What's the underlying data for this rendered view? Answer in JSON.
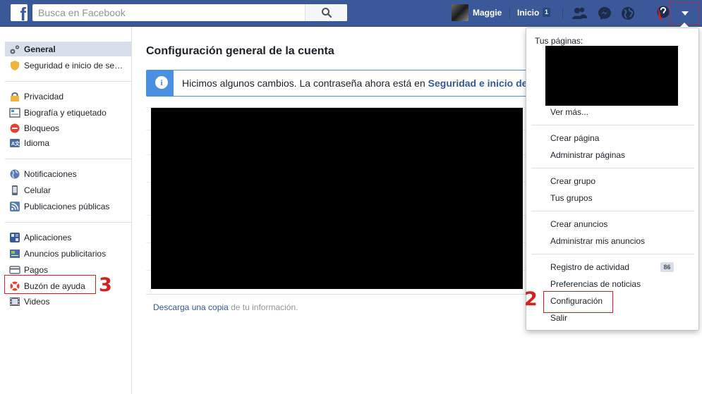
{
  "topbar": {
    "logo": "f",
    "search_placeholder": "Busca en Facebook",
    "search_icon": "search-icon",
    "profile_name": "Maggie",
    "home_label": "Inicio",
    "home_badge": "1",
    "icons": [
      "friend-requests-icon",
      "messenger-icon",
      "notifications-globe-icon",
      "help-icon",
      "dropdown-caret-icon"
    ],
    "color_bg": "#3b5998"
  },
  "sidebar": {
    "items": [
      {
        "label": "General",
        "icon": "gear-icon",
        "active": true
      },
      {
        "label": "Seguridad e inicio de sesión",
        "icon": "shield-icon"
      },
      {
        "label": "Privacidad",
        "icon": "lock-icon"
      },
      {
        "label": "Biografía y etiquetado",
        "icon": "timeline-icon"
      },
      {
        "label": "Bloqueos",
        "icon": "block-icon"
      },
      {
        "label": "Idioma",
        "icon": "language-icon"
      },
      {
        "label": "Notificaciones",
        "icon": "globe-icon"
      },
      {
        "label": "Celular",
        "icon": "mobile-icon"
      },
      {
        "label": "Publicaciones públicas",
        "icon": "rss-icon"
      },
      {
        "label": "Aplicaciones",
        "icon": "apps-icon"
      },
      {
        "label": "Anuncios publicitarios",
        "icon": "ads-icon"
      },
      {
        "label": "Pagos",
        "icon": "credit-card-icon"
      },
      {
        "label": "Buzón de ayuda",
        "icon": "lifebuoy-icon"
      },
      {
        "label": "Videos",
        "icon": "film-icon"
      }
    ],
    "annotation": "3"
  },
  "main": {
    "title": "Configuración general de la cuenta",
    "notice": {
      "icon": "info-icon",
      "text": "Hicimos algunos cambios. La contraseña ahora está en ",
      "link": "Seguridad e inicio de"
    },
    "download": {
      "pre": "Descarga ",
      "link1": "una copia",
      "post": " de tu información."
    }
  },
  "dropdown": {
    "pages_label": "Tus páginas:",
    "see_more": "Ver más...",
    "groups": [
      [
        "Crear página",
        "Administrar páginas"
      ],
      [
        "Crear grupo",
        "Tus grupos"
      ],
      [
        "Crear anuncios",
        "Administrar mis anuncios"
      ],
      [
        "Registro de actividad",
        "Preferencias de noticias",
        "Configuración",
        "Salir"
      ]
    ],
    "activity_badge": "86",
    "annotation": "2"
  }
}
